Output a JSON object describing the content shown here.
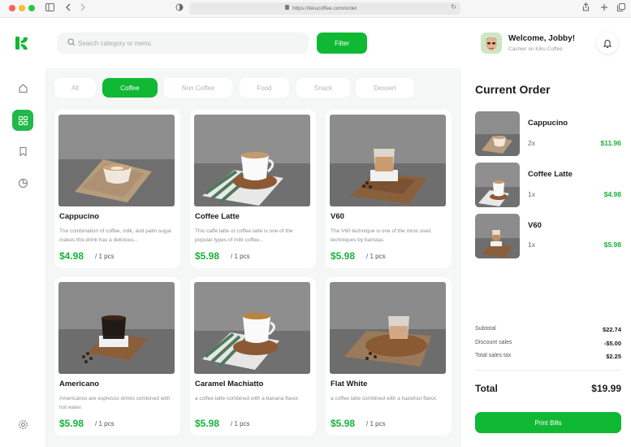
{
  "browser": {
    "url": "https://kikucoffee.com/order"
  },
  "search": {
    "placeholder": "Search category or menu"
  },
  "toolbar": {
    "filter_label": "Filter"
  },
  "user": {
    "welcome": "Welcome, Jobby!",
    "role": "Cashier on Kiku Coffee"
  },
  "categories": [
    {
      "label": "All"
    },
    {
      "label": "Coffee"
    },
    {
      "label": "Non Coffee"
    },
    {
      "label": "Food"
    },
    {
      "label": "Snack"
    },
    {
      "label": "Dessert"
    }
  ],
  "active_category": "Coffee",
  "products": [
    {
      "name": "Cappucino",
      "desc": "The combination of coffee, milk, and palm sugar makes this drink has a delicious...",
      "price": "$4.98",
      "unit": "/ 1 pcs"
    },
    {
      "name": "Coffee Latte",
      "desc": "This caffè latte or coffee latte is one of the popular types of milk coffee...",
      "price": "$5.98",
      "unit": "/ 1 pcs"
    },
    {
      "name": "V60",
      "desc": "The V60 technique is one of the most used techniques by baristas.",
      "price": "$5.98",
      "unit": "/ 1 pcs"
    },
    {
      "name": "Americano",
      "desc": "Americanos are espresso drinks combined with hot water.",
      "price": "$5.98",
      "unit": "/ 1 pcs"
    },
    {
      "name": "Caramel Machiatto",
      "desc": "a coffee latte combined with a banana flavor.",
      "price": "$5.98",
      "unit": "/ 1 pcs"
    },
    {
      "name": "Flat White",
      "desc": "a coffee latte combined with a hazelnut flavor.",
      "price": "$5.98",
      "unit": "/ 1 pcs"
    }
  ],
  "order": {
    "title": "Current Order",
    "items": [
      {
        "name": "Cappucino",
        "qty": "2x",
        "price": "$11.96"
      },
      {
        "name": "Coffee Latte",
        "qty": "1x",
        "price": "$4.98"
      },
      {
        "name": "V60",
        "qty": "1x",
        "price": "$5.98"
      }
    ],
    "subtotal_label": "Subtotal",
    "subtotal": "$22.74",
    "discount_label": "Discount sales",
    "discount": "-$5.00",
    "tax_label": "Total sales tax",
    "tax": "$2.25",
    "total_label": "Total",
    "total": "$19.99",
    "print_label": "Print Bills"
  },
  "colors": {
    "accent": "#0fb934",
    "price": "#16b33a",
    "background": "#f5f6f6"
  },
  "icons": {
    "sidebar": [
      "home-icon",
      "grid-icon",
      "bookmark-icon",
      "pie-chart-icon",
      "settings-icon"
    ],
    "topbar": [
      "search-icon",
      "bell-icon"
    ]
  }
}
